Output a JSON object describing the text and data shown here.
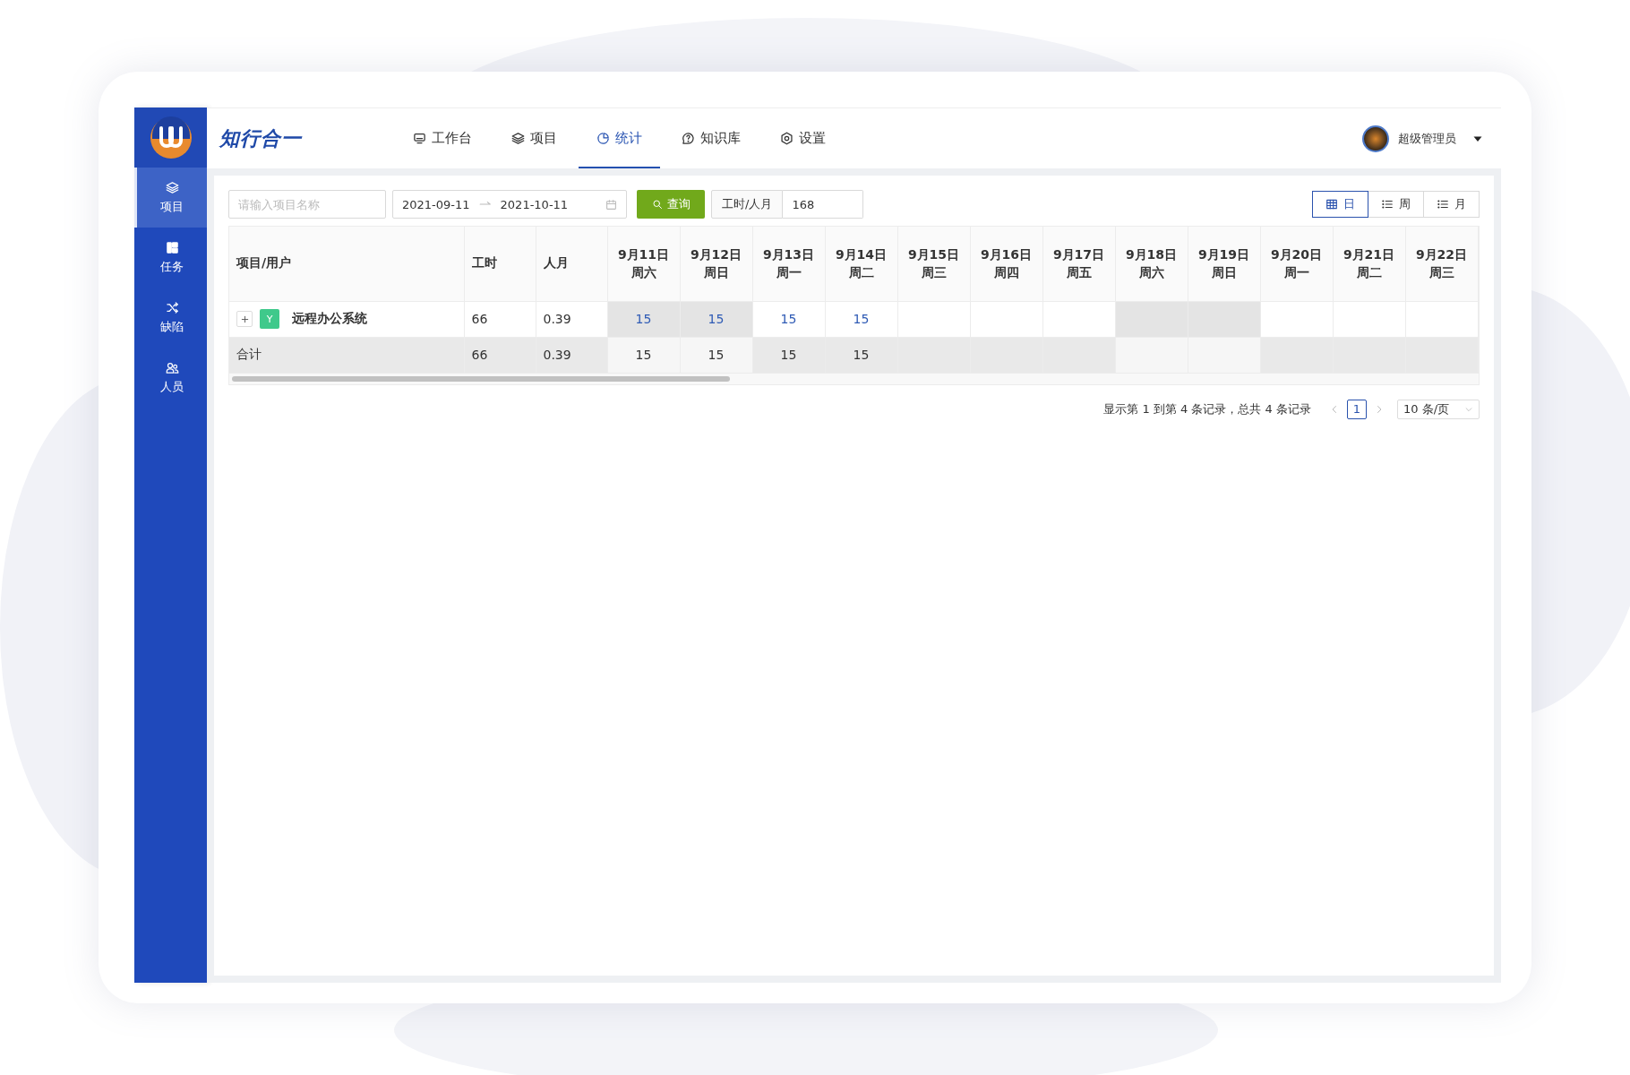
{
  "sidebar": {
    "items": [
      {
        "label": "项目",
        "selected": true
      },
      {
        "label": "任务",
        "selected": false
      },
      {
        "label": "缺陷",
        "selected": false
      },
      {
        "label": "人员",
        "selected": false
      }
    ]
  },
  "header": {
    "brand": "知行合一",
    "nav": [
      {
        "label": "工作台",
        "selected": false
      },
      {
        "label": "项目",
        "selected": false
      },
      {
        "label": "统计",
        "selected": true
      },
      {
        "label": "知识库",
        "selected": false
      },
      {
        "label": "设置",
        "selected": false
      }
    ],
    "user": {
      "name": "超级管理员"
    }
  },
  "toolbar": {
    "search": {
      "placeholder": "请输入项目名称"
    },
    "date_range": {
      "start": "2021-09-11",
      "end": "2021-10-11"
    },
    "query_button": "查询",
    "ratio": {
      "label": "工时/人月",
      "value": "168"
    },
    "views": [
      {
        "label": "日",
        "selected": true
      },
      {
        "label": "周",
        "selected": false
      },
      {
        "label": "月",
        "selected": false
      }
    ]
  },
  "table": {
    "columns": [
      "项目/用户",
      "工时",
      "人月"
    ],
    "date_columns": [
      {
        "date": "9月11日",
        "weekday": "周六",
        "weekend": true
      },
      {
        "date": "9月12日",
        "weekday": "周日",
        "weekend": true
      },
      {
        "date": "9月13日",
        "weekday": "周一",
        "weekend": false
      },
      {
        "date": "9月14日",
        "weekday": "周二",
        "weekend": false
      },
      {
        "date": "9月15日",
        "weekday": "周三",
        "weekend": false
      },
      {
        "date": "9月16日",
        "weekday": "周四",
        "weekend": false
      },
      {
        "date": "9月17日",
        "weekday": "周五",
        "weekend": false
      },
      {
        "date": "9月18日",
        "weekday": "周六",
        "weekend": true
      },
      {
        "date": "9月19日",
        "weekday": "周日",
        "weekend": true
      },
      {
        "date": "9月20日",
        "weekday": "周一",
        "weekend": false
      },
      {
        "date": "9月21日",
        "weekday": "周二",
        "weekend": false
      },
      {
        "date": "9月22日",
        "weekday": "周三",
        "weekend": false
      }
    ],
    "rows": [
      {
        "kind": "project",
        "tag": "Y",
        "name": "远程办公系统",
        "hours": "66",
        "months": "0.39",
        "values": [
          "15",
          "15",
          "15",
          "15"
        ]
      },
      {
        "kind": "total",
        "name": "合计",
        "hours": "66",
        "months": "0.39",
        "values": [
          "15",
          "15",
          "15",
          "15"
        ]
      }
    ]
  },
  "pagination": {
    "summary": "显示第 1 到第 4 条记录，总共 4 条记录",
    "pages": [
      {
        "label": "1",
        "selected": true
      }
    ],
    "page_size": "10 条/页"
  }
}
